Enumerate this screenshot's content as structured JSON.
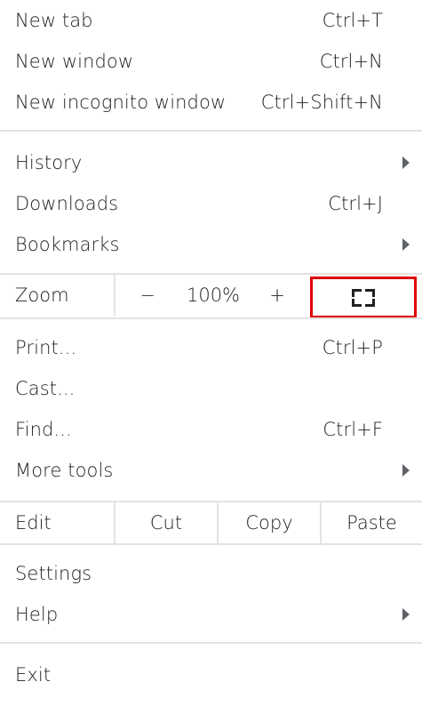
{
  "menu": {
    "group1": [
      {
        "label": "New tab",
        "shortcut": "Ctrl+T"
      },
      {
        "label": "New window",
        "shortcut": "Ctrl+N"
      },
      {
        "label": "New incognito window",
        "shortcut": "Ctrl+Shift+N"
      }
    ],
    "group2": [
      {
        "label": "History",
        "submenu": true
      },
      {
        "label": "Downloads",
        "shortcut": "Ctrl+J"
      },
      {
        "label": "Bookmarks",
        "submenu": true
      }
    ],
    "zoom": {
      "label": "Zoom",
      "minus": "−",
      "value": "100%",
      "plus": "+",
      "fullscreen_icon": "fullscreen-icon",
      "highlight_color": "#e00000"
    },
    "group3": [
      {
        "label": "Print...",
        "shortcut": "Ctrl+P"
      },
      {
        "label": "Cast..."
      },
      {
        "label": "Find...",
        "shortcut": "Ctrl+F"
      },
      {
        "label": "More tools",
        "submenu": true
      }
    ],
    "edit": {
      "label": "Edit",
      "cut": "Cut",
      "copy": "Copy",
      "paste": "Paste"
    },
    "group4": [
      {
        "label": "Settings"
      },
      {
        "label": "Help",
        "submenu": true
      }
    ],
    "exit": {
      "label": "Exit"
    }
  }
}
